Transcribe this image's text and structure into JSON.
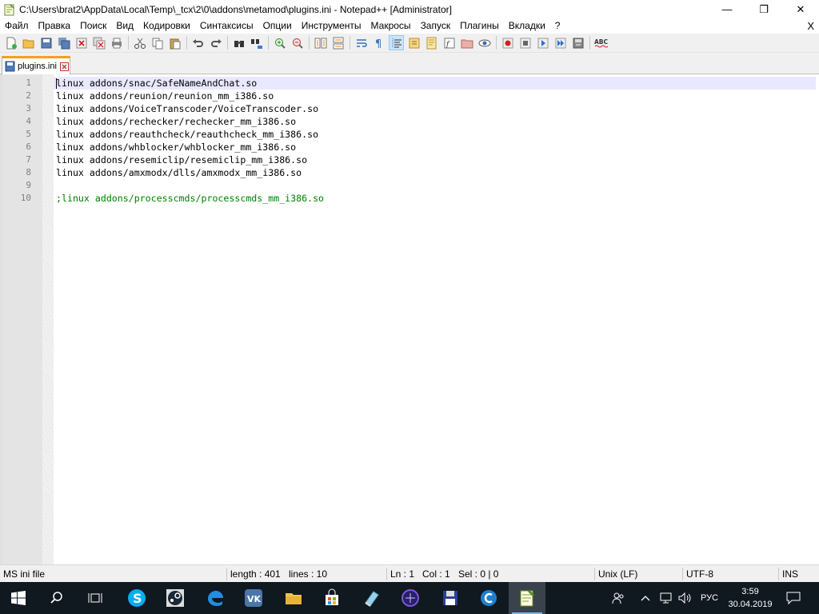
{
  "window": {
    "title": "C:\\Users\\brat2\\AppData\\Local\\Temp\\_tcx\\2\\0\\addons\\metamod\\plugins.ini - Notepad++ [Administrator]",
    "app_icon": "notepadpp-icon",
    "minimize": "—",
    "maximize": "❐",
    "close": "✕"
  },
  "menu": {
    "items": [
      "Файл",
      "Правка",
      "Поиск",
      "Вид",
      "Кодировки",
      "Синтаксисы",
      "Опции",
      "Инструменты",
      "Макросы",
      "Запуск",
      "Плагины",
      "Вкладки",
      "?"
    ],
    "close_doc": "X"
  },
  "toolbar": {
    "icons": [
      "new-file-icon",
      "open-file-icon",
      "save-icon",
      "save-all-icon",
      "close-icon",
      "close-all-icon",
      "print-icon",
      "cut-icon",
      "copy-icon",
      "paste-icon",
      "undo-icon",
      "redo-icon",
      "find-icon",
      "replace-icon",
      "zoom-in-icon",
      "zoom-out-icon",
      "sync-vertical-icon",
      "sync-horizontal-icon",
      "word-wrap-icon",
      "show-all-chars-icon",
      "indent-guide-icon",
      "language-icon",
      "doc-map-icon",
      "function-list-icon",
      "folder-workspace-icon",
      "monitoring-icon",
      "record-macro-icon",
      "stop-record-icon",
      "play-macro-icon",
      "run-macro-multiple-icon",
      "save-macro-icon",
      "spell-check-icon"
    ],
    "active_index": 20
  },
  "tab": {
    "label": "plugins.ini",
    "accent": "#fa9e1e"
  },
  "editor": {
    "current_line": 1,
    "lines": [
      {
        "num": "1",
        "text": "linux addons/snac/SafeNameAndChat.so",
        "comment": false
      },
      {
        "num": "2",
        "text": "linux addons/reunion/reunion_mm_i386.so",
        "comment": false
      },
      {
        "num": "3",
        "text": "linux addons/VoiceTranscoder/VoiceTranscoder.so",
        "comment": false
      },
      {
        "num": "4",
        "text": "linux addons/rechecker/rechecker_mm_i386.so",
        "comment": false
      },
      {
        "num": "5",
        "text": "linux addons/reauthcheck/reauthcheck_mm_i386.so",
        "comment": false
      },
      {
        "num": "6",
        "text": "linux addons/whblocker/whblocker_mm_i386.so",
        "comment": false
      },
      {
        "num": "7",
        "text": "linux addons/resemiclip/resemiclip_mm_i386.so",
        "comment": false
      },
      {
        "num": "8",
        "text": "linux addons/amxmodx/dlls/amxmodx_mm_i386.so",
        "comment": false
      },
      {
        "num": "9",
        "text": "",
        "comment": false
      },
      {
        "num": "10",
        "text": ";linux addons/processcmds/processcmds_mm_i386.so",
        "comment": true
      }
    ],
    "comment_color": "#008000"
  },
  "status": {
    "file_type": "MS ini file",
    "length": "length : 401",
    "lines": "lines : 10",
    "ln": "Ln : 1",
    "col": "Col : 1",
    "sel": "Sel : 0 | 0",
    "eol": "Unix (LF)",
    "encoding": "UTF-8",
    "mode": "INS"
  },
  "taskbar": {
    "apps": [
      "windows-start-icon",
      "search-icon",
      "task-view-icon",
      "skype-icon",
      "steam-icon",
      "edge-icon",
      "vk-icon",
      "file-explorer-icon",
      "store-icon",
      "tool-app-icon",
      "app-circle-icon",
      "floppy-app-icon",
      "ccleaner-icon",
      "notepadpp-icon"
    ],
    "active_app": "notepadpp-icon",
    "lang": "РУС",
    "time": "3:59",
    "date": "30.04.2019"
  }
}
